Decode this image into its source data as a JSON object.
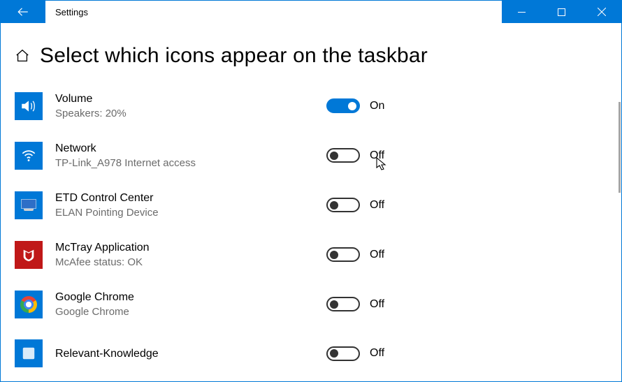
{
  "window": {
    "title": "Settings"
  },
  "page": {
    "heading": "Select which icons appear on the taskbar"
  },
  "toggle_labels": {
    "on": "On",
    "off": "Off"
  },
  "items": [
    {
      "id": "volume",
      "title": "Volume",
      "subtitle": "Speakers: 20%",
      "state": "on",
      "icon": "volume-icon"
    },
    {
      "id": "network",
      "title": "Network",
      "subtitle": "TP-Link_A978 Internet access",
      "state": "off",
      "icon": "wifi-icon"
    },
    {
      "id": "etd-control-center",
      "title": "ETD Control Center",
      "subtitle": "ELAN Pointing Device",
      "state": "off",
      "icon": "monitor-icon"
    },
    {
      "id": "mctray",
      "title": "McTray Application",
      "subtitle": "McAfee status: OK",
      "state": "off",
      "icon": "mcafee-icon"
    },
    {
      "id": "google-chrome",
      "title": "Google Chrome",
      "subtitle": "Google Chrome",
      "state": "off",
      "icon": "chrome-icon"
    },
    {
      "id": "relevant-knowledge",
      "title": "Relevant-Knowledge",
      "subtitle": "",
      "state": "off",
      "icon": "generic-icon"
    }
  ]
}
